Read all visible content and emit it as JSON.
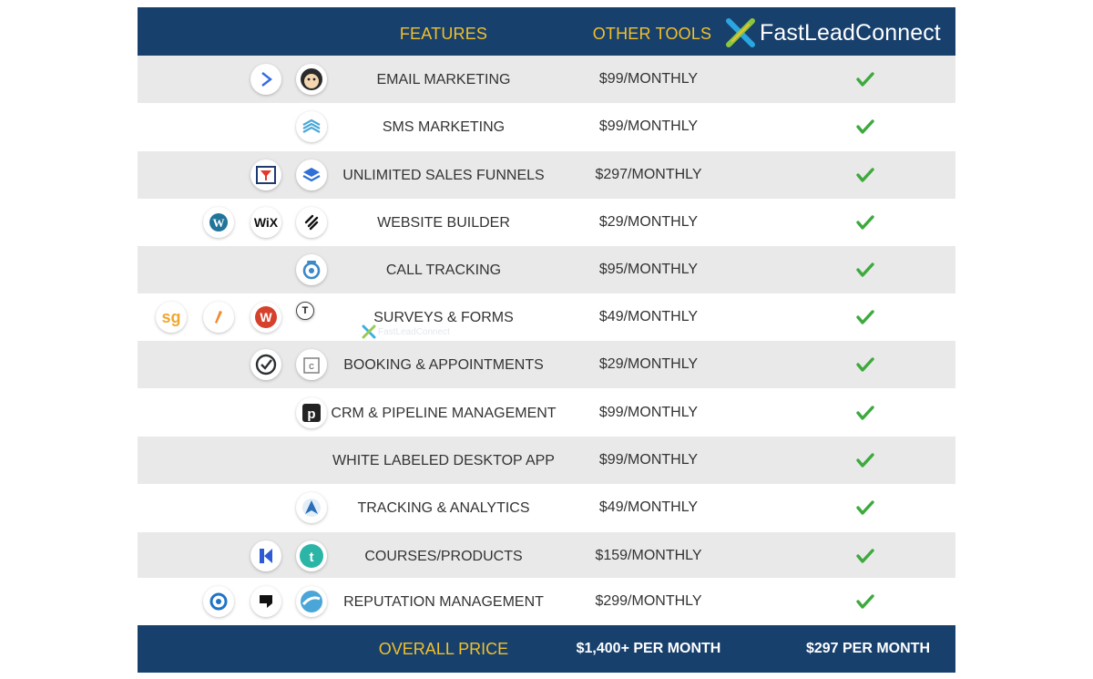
{
  "header": {
    "features_label": "FEATURES",
    "other_tools_label": "OTHER TOOLS",
    "brand_name": "FastLeadConnect"
  },
  "rows": [
    {
      "feature": "EMAIL MARKETING",
      "price": "$99/MONTHLY",
      "icons": [
        "activecampaign-icon",
        "mailchimp-icon"
      ]
    },
    {
      "feature": "SMS MARKETING",
      "price": "$99/MONTHLY",
      "icons": [
        "sms-layers-icon"
      ]
    },
    {
      "feature": "UNLIMITED SALES FUNNELS",
      "price": "$297/MONTHLY",
      "icons": [
        "clickfunnels-icon",
        "leadpages-icon"
      ]
    },
    {
      "feature": "WEBSITE BUILDER",
      "price": "$29/MONTHLY",
      "icons": [
        "wordpress-icon",
        "wix-icon",
        "squarespace-icon"
      ]
    },
    {
      "feature": "CALL TRACKING",
      "price": "$95/MONTHLY",
      "icons": [
        "callrail-icon"
      ]
    },
    {
      "feature": "SURVEYS & FORMS",
      "price": "$49/MONTHLY",
      "icons": [
        "surveygizmo-icon",
        "formstack-icon",
        "wufoo-icon",
        "typeform-icon"
      ]
    },
    {
      "feature": "BOOKING & APPOINTMENTS",
      "price": "$29/MONTHLY",
      "icons": [
        "acuity-icon",
        "calendly-icon"
      ]
    },
    {
      "feature": "CRM & PIPELINE MANAGEMENT",
      "price": "$99/MONTHLY",
      "icons": [
        "pipedrive-icon"
      ]
    },
    {
      "feature": "WHITE LABELED DESKTOP APP",
      "price": "$99/MONTHLY",
      "icons": []
    },
    {
      "feature": "TRACKING & ANALYTICS",
      "price": "$49/MONTHLY",
      "icons": [
        "analytics-icon"
      ]
    },
    {
      "feature": "COURSES/PRODUCTS",
      "price": "$159/MONTHLY",
      "icons": [
        "kajabi-icon",
        "teachable-icon"
      ]
    },
    {
      "feature": "REPUTATION MANAGEMENT",
      "price": "$299/MONTHLY",
      "icons": [
        "birdeye-icon",
        "podium-icon",
        "reputation-icon"
      ]
    }
  ],
  "footer": {
    "overall_label": "OVERALL PRICE",
    "other_total": "$1,400+ PER MONTH",
    "brand_total": "$297 PER MONTH"
  },
  "watermark": "FastLeadConnect",
  "colors": {
    "header_bg": "#17406d",
    "accent_yellow": "#f2c02b",
    "check_green": "#3daa3d",
    "row_alt": "#e9e9e9"
  }
}
